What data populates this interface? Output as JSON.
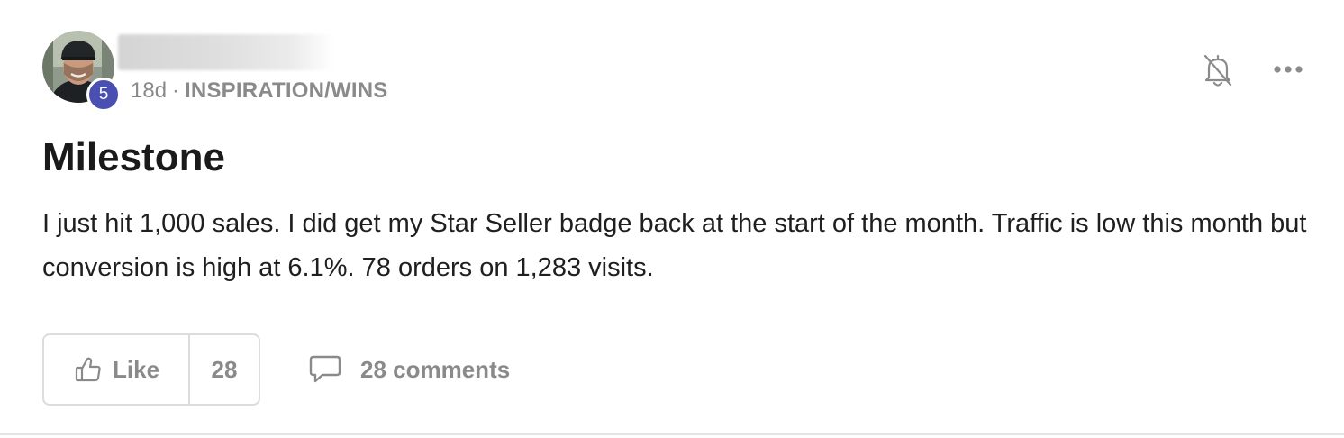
{
  "post": {
    "author": {
      "level": "5"
    },
    "meta": {
      "age": "18d",
      "separator": "·",
      "category": "INSPIRATION/WINS"
    },
    "title": "Milestone",
    "body": "I just hit 1,000 sales. I did get my Star Seller badge back at the start of the month. Traffic is low this month but conversion is high at 6.1%. 78 orders on 1,283 visits.",
    "actions": {
      "like_label": "Like",
      "like_count": "28",
      "comments_label": "28 comments"
    },
    "icons": {
      "notifications": "bell-off-icon",
      "more": "more-horizontal-icon",
      "like": "thumbs-up-icon",
      "comments": "comment-bubble-icon"
    },
    "colors": {
      "level_badge": "#4a4fb2",
      "muted_text": "#8a8a8a",
      "border": "#dcdcdc"
    }
  }
}
